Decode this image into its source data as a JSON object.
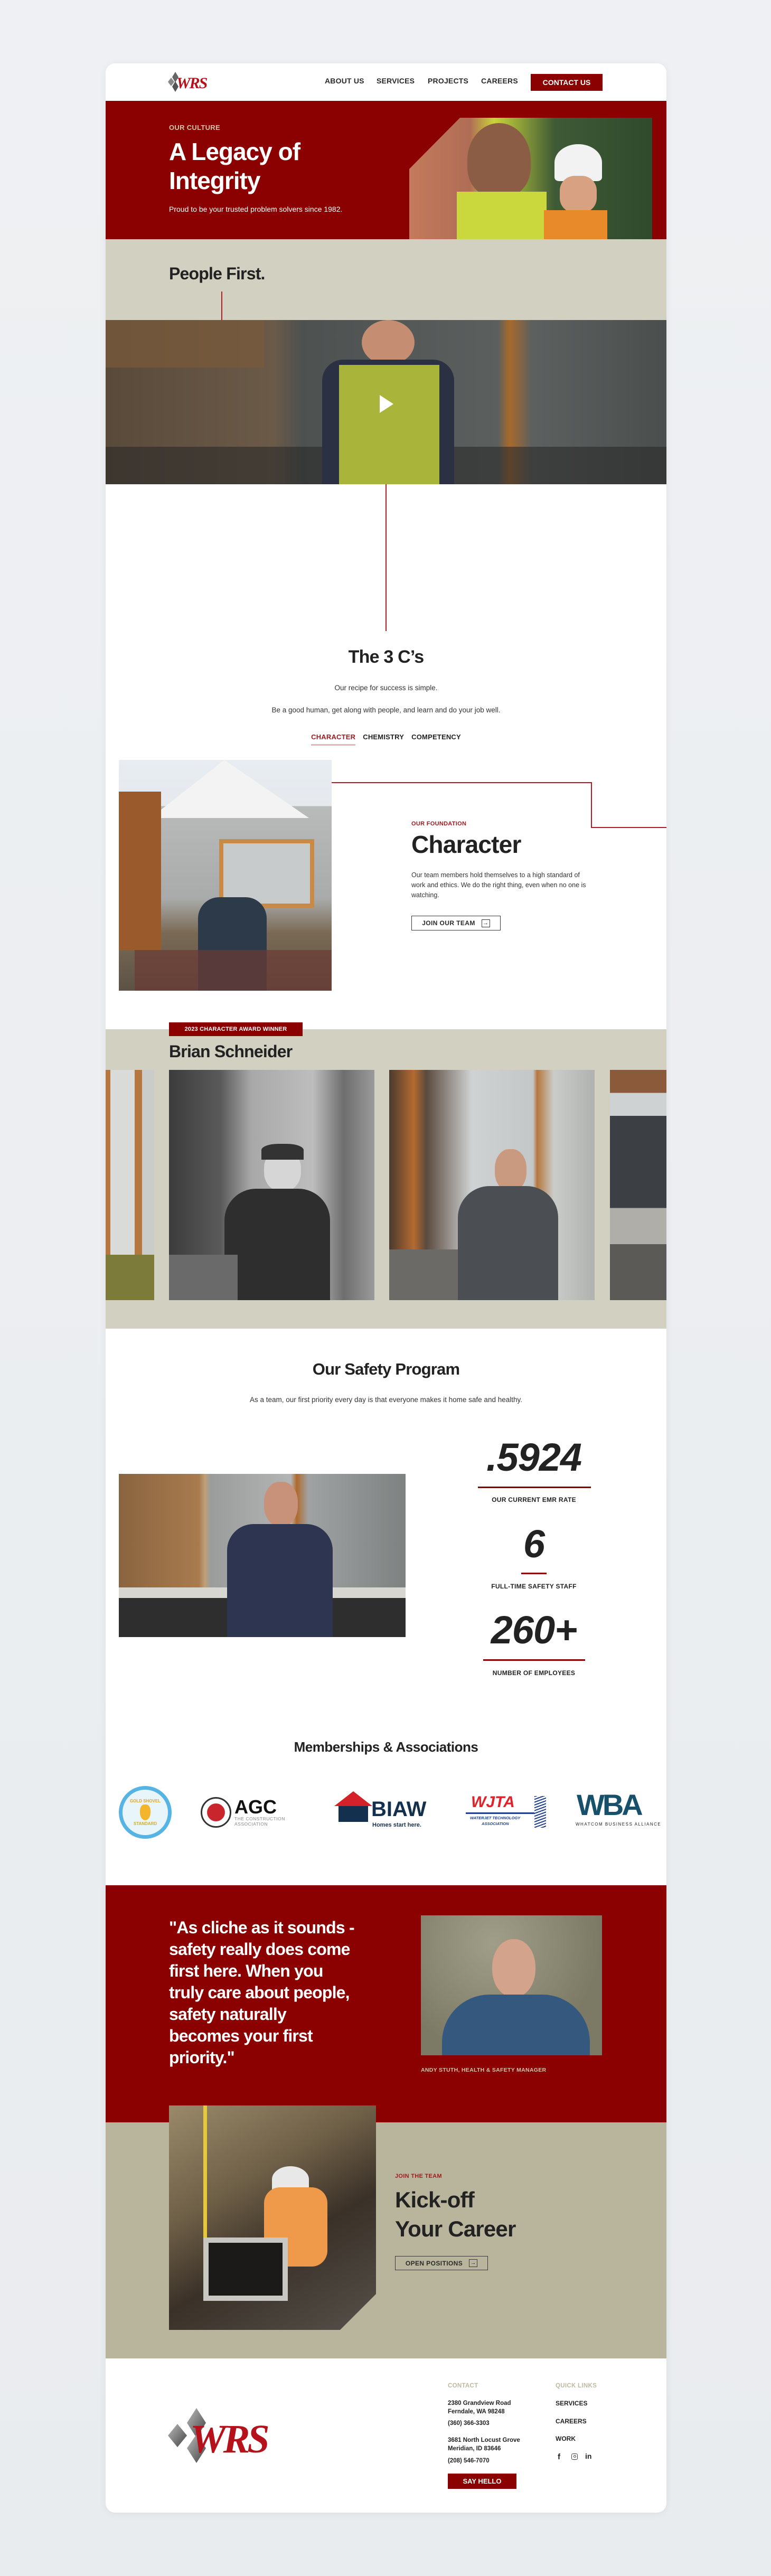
{
  "colors": {
    "brand_red": "#8b0000",
    "beige": "#d2d0c1",
    "career_beige": "#b9b59d",
    "caption_beige": "#cfc6aa"
  },
  "nav": {
    "logo_text": "WRS",
    "links": [
      "ABOUT US",
      "SERVICES",
      "PROJECTS",
      "CAREERS"
    ],
    "contact": "CONTACT US"
  },
  "hero": {
    "eyebrow": "OUR CULTURE",
    "title_line1": "A Legacy of",
    "title_line2": "Integrity",
    "subtitle": "Proud to be your trusted problem solvers since 1982."
  },
  "people": {
    "title": "People First.",
    "video_icon": "play-icon"
  },
  "three_cs": {
    "title": "The 3 C’s",
    "intro": "Our recipe for success is simple.",
    "summary": "Be a good human, get along with people, and learn and do your job well.",
    "tabs": [
      {
        "label": "CHARACTER",
        "active": true
      },
      {
        "label": "CHEMISTRY",
        "active": false
      },
      {
        "label": "COMPETENCY",
        "active": false
      }
    ]
  },
  "character": {
    "eyebrow": "OUR FOUNDATION",
    "title": "Character",
    "body": "Our team members hold themselves to a high standard of work and ethics. We do the right thing, even when no one is watching.",
    "button": "JOIN OUR TEAM",
    "button_icon": "arrow-right-icon"
  },
  "award": {
    "badge": "2023 CHARACTER AWARD WINNER",
    "name": "Brian Schneider"
  },
  "safety": {
    "title": "Our Safety Program",
    "subtitle": "As a team, our first priority every day is that everyone makes it home safe and healthy.",
    "stats": [
      {
        "value": ".5924",
        "label": "OUR CURRENT EMR RATE"
      },
      {
        "value": "6",
        "label": "FULL-TIME SAFETY STAFF"
      },
      {
        "value": "260+",
        "label": "NUMBER OF EMPLOYEES"
      }
    ]
  },
  "memberships": {
    "title": "Memberships & Associations",
    "logos": [
      {
        "name": "Gold Shovel Standard",
        "top": "GOLD SHOVEL",
        "bottom": "STANDARD"
      },
      {
        "name": "AGC",
        "mark": "AGC",
        "line1": "THE CONSTRUCTION",
        "line2": "ASSOCIATION"
      },
      {
        "name": "BIAW",
        "mark": "BIAW",
        "tagline": "Homes start here."
      },
      {
        "name": "WJTA",
        "mark": "WJTA",
        "line1": "WATERJET TECHNOLOGY",
        "line2": "ASSOCIATION"
      },
      {
        "name": "WBA",
        "mark": "WBA",
        "line1": "WHATCOM BUSINESS ALLIANCE"
      }
    ]
  },
  "quote": {
    "text": "\"As cliche as it sounds - safety really does come first here. When you truly care about people, safety naturally becomes your first priority.\"",
    "attribution": "ANDY STUTH, HEALTH & SAFETY MANAGER"
  },
  "careers": {
    "eyebrow": "JOIN THE TEAM",
    "title_line1": "Kick-off",
    "title_line2": "Your Career",
    "button": "OPEN POSITIONS",
    "button_icon": "arrow-right-icon"
  },
  "footer": {
    "contact_heading": "CONTACT",
    "offices": [
      {
        "line1": "2380 Grandview Road",
        "line2": "Ferndale, WA 98248",
        "phone": "(360) 366-3303"
      },
      {
        "line1": "3681 North Locust Grove",
        "line2": "Meridian, ID 83646",
        "phone": "(208) 546-7070"
      }
    ],
    "say_hello": "SAY HELLO",
    "quick_links_heading": "QUICK LINKS",
    "quick_links": [
      "SERVICES",
      "CAREERS",
      "WORK"
    ],
    "social": [
      "facebook-icon",
      "instagram-icon",
      "linkedin-icon"
    ]
  }
}
